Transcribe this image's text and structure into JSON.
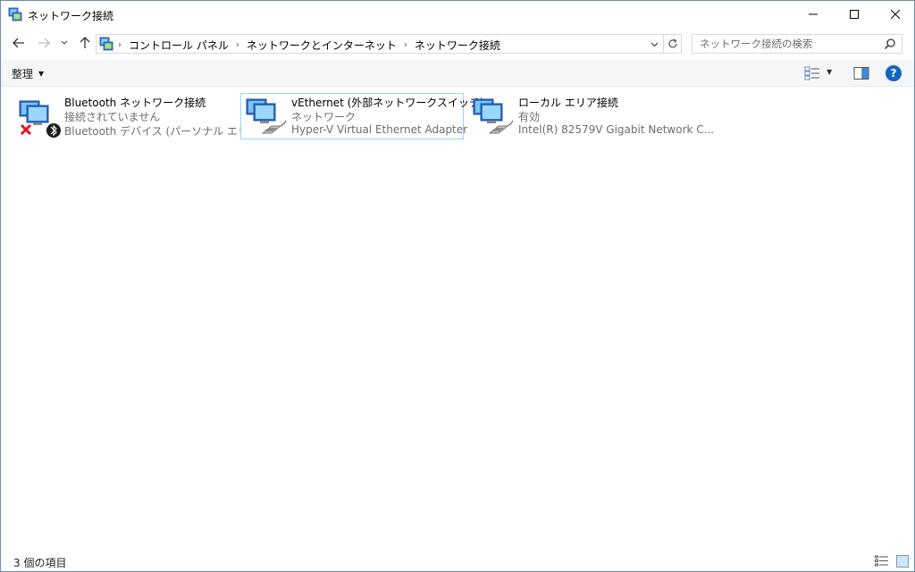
{
  "window": {
    "title": "ネットワーク接続",
    "controls": {
      "minimize_icon": "minimize-icon",
      "maximize_icon": "maximize-icon",
      "close_icon": "close-icon"
    }
  },
  "navigation": {
    "breadcrumb": [
      "コントロール パネル",
      "ネットワークとインターネット",
      "ネットワーク接続"
    ],
    "search_placeholder": "ネットワーク接続の検索"
  },
  "command_bar": {
    "organize_label": "整理",
    "help_label": "?"
  },
  "connections": [
    {
      "name": "Bluetooth ネットワーク接続",
      "status": "接続されていません",
      "device": "Bluetooth デバイス (パーソナル エリア ...",
      "icon": "network-disconnected-bluetooth-icon",
      "selected": false
    },
    {
      "name": "vEthernet (外部ネットワークスイッチ)",
      "status": "ネットワーク",
      "device": "Hyper-V Virtual Ethernet Adapter",
      "icon": "network-ethernet-icon",
      "selected": true
    },
    {
      "name": "ローカル エリア接続",
      "status": "有効",
      "device": "Intel(R) 82579V Gigabit Network C...",
      "icon": "network-ethernet-icon",
      "selected": false
    }
  ],
  "status_bar": {
    "item_count": "3 個の項目"
  },
  "colors": {
    "accent": "#1565c0",
    "selection_border": "#99d1ff",
    "error_red": "#e81123"
  }
}
